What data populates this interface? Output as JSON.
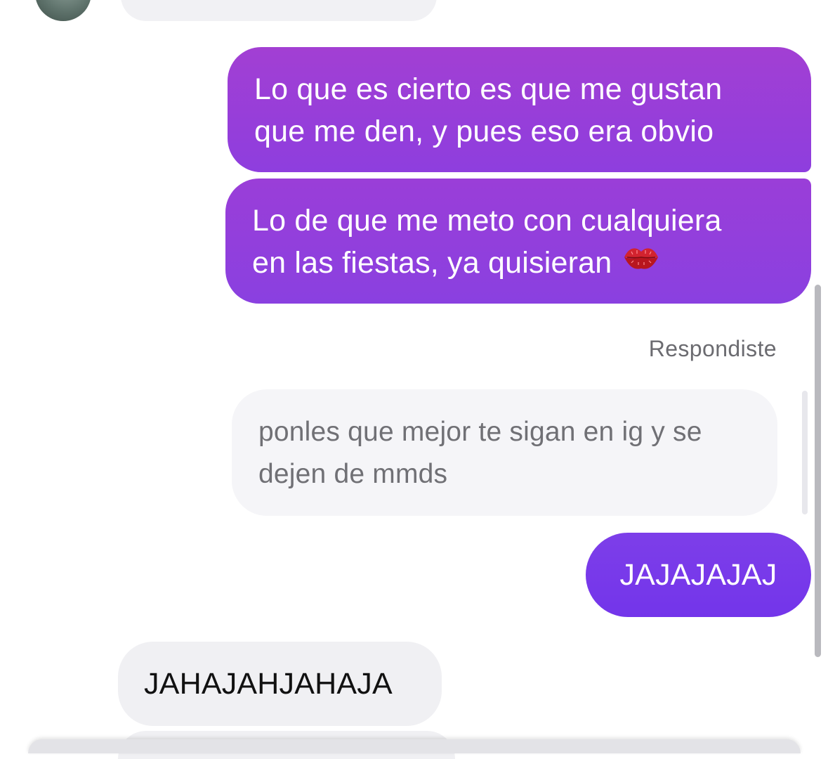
{
  "conversation": {
    "messages": [
      {
        "sender": "me",
        "text_line1": "Lo que es cierto es que me gustan",
        "text_line2": "que me den, y pues eso era obvio"
      },
      {
        "sender": "me",
        "text_line1": "Lo de que me meto con cualquiera",
        "text_line2": "en las fiestas, ya quisieran",
        "emoji": "kiss-mark-icon"
      },
      {
        "sender": "me",
        "text": "JAJAJAJAJ"
      },
      {
        "sender": "them",
        "text": "JAHAJAHJAHAJA"
      }
    ],
    "reply": {
      "label": "Respondiste",
      "quoted_line1": "ponles que mejor te sigan en ig y se",
      "quoted_line2": "dejen de mmds"
    }
  },
  "colors": {
    "sent_top": "#a23fd3",
    "sent_bottom": "#7335ea",
    "received_bg": "#f0f0f3",
    "quoted_bg": "#f5f5f8",
    "label_text": "#6b6b70"
  }
}
